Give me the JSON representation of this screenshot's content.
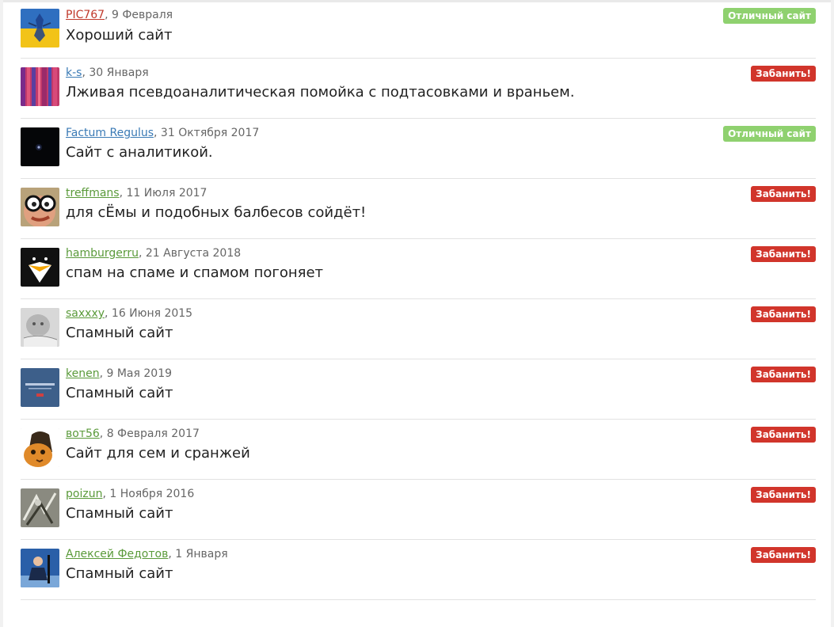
{
  "reviews": [
    {
      "author": "PIC767",
      "date": ", 9 Февраля",
      "text": "Хороший сайт",
      "badge": "Отличный сайт",
      "badge_type": "good",
      "author_color": "red",
      "avatar_icon": "ukraine-flag-avatar-icon"
    },
    {
      "author": "k-s",
      "date": ", 30 Января",
      "text": "Лживая псевдоаналитическая помойка с подтасовками и враньем.",
      "badge": "Забанить!",
      "badge_type": "ban",
      "author_color": "blue",
      "avatar_icon": "stripes-avatar-icon"
    },
    {
      "author": "Factum Regulus",
      "date": ", 31 Октября 2017",
      "text": "Сайт с аналитикой.",
      "badge": "Отличный сайт",
      "badge_type": "good",
      "author_color": "blue",
      "avatar_icon": "dark-star-avatar-icon"
    },
    {
      "author": "treffmans",
      "date": ", 11 Июля 2017",
      "text": "для сЁмы и подобных балбесов сойдёт!",
      "badge": "Забанить!",
      "badge_type": "ban",
      "author_color": "green",
      "avatar_icon": "glasses-face-avatar-icon"
    },
    {
      "author": "hamburgerru",
      "date": ", 21 Августа 2018",
      "text": "спам на спаме и спамом погоняет",
      "badge": "Забанить!",
      "badge_type": "ban",
      "author_color": "green",
      "avatar_icon": "penguin-avatar-icon"
    },
    {
      "author": "saxxxy",
      "date": ", 16 Июня 2015",
      "text": "Спамный сайт",
      "badge": "Забанить!",
      "badge_type": "ban",
      "author_color": "green",
      "avatar_icon": "baby-photo-avatar-icon"
    },
    {
      "author": "kenen",
      "date": ", 9 Мая 2019",
      "text": "Спамный сайт",
      "badge": "Забанить!",
      "badge_type": "ban",
      "author_color": "green",
      "avatar_icon": "blue-banner-avatar-icon"
    },
    {
      "author": "вот56",
      "date": ", 8 Февраля 2017",
      "text": "Сайт для сем и сранжей",
      "badge": "Забанить!",
      "badge_type": "ban",
      "author_color": "green",
      "avatar_icon": "cat-avatar-icon"
    },
    {
      "author": "poizun",
      "date": ", 1 Ноября 2016",
      "text": "Спамный сайт",
      "badge": "Забанить!",
      "badge_type": "ban",
      "author_color": "green",
      "avatar_icon": "sketch-avatar-icon"
    },
    {
      "author": "Алексей Федотов",
      "date": ", 1 Января",
      "text": "Спамный сайт",
      "badge": "Забанить!",
      "badge_type": "ban",
      "author_color": "green",
      "avatar_icon": "person-blue-avatar-icon"
    }
  ],
  "colors": {
    "good_badge": "#8fd16f",
    "ban_badge": "#d1352b",
    "author_red": "#c0392b",
    "author_blue": "#3a7ab5",
    "author_green": "#5a9a3a",
    "separator": "#e2e2e2"
  }
}
